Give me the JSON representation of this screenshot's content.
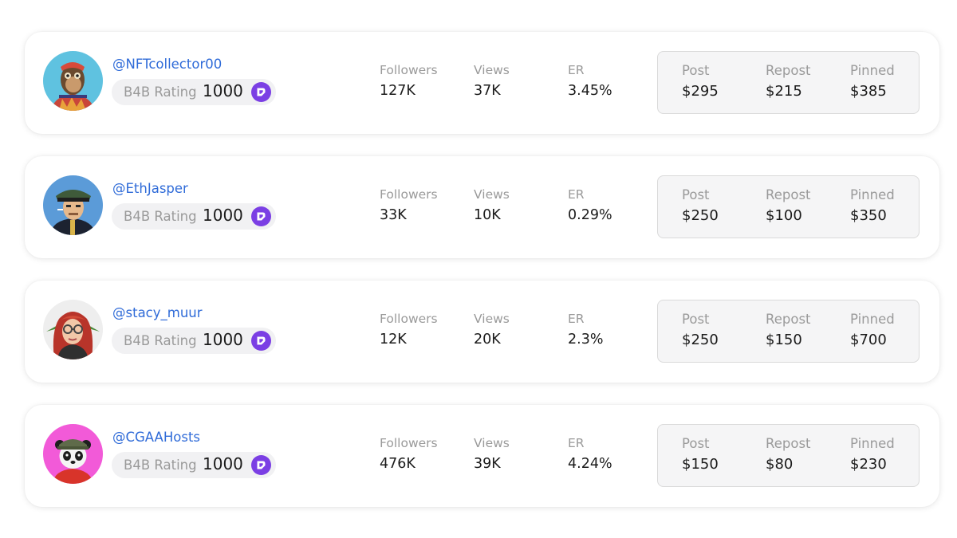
{
  "rating_label": "B4B Rating",
  "stat_labels": {
    "followers": "Followers",
    "views": "Views",
    "er": "ER"
  },
  "price_labels": {
    "post": "Post",
    "repost": "Repost",
    "pinned": "Pinned"
  },
  "colors": {
    "handle": "#2f6bd8",
    "rating_icon": "#7b3fe4",
    "muted_text": "#9a9a9a"
  },
  "influencers": [
    {
      "handle": "@NFTcollector00",
      "avatar_icon": "ape-avatar-icon",
      "rating": "1000",
      "followers": "127K",
      "views": "37K",
      "er": "3.45%",
      "post_price": "$295",
      "repost_price": "$215",
      "pinned_price": "$385"
    },
    {
      "handle": "@EthJasper",
      "avatar_icon": "officer-avatar-icon",
      "rating": "1000",
      "followers": "33K",
      "views": "10K",
      "er": "0.29%",
      "post_price": "$250",
      "repost_price": "$100",
      "pinned_price": "$350"
    },
    {
      "handle": "@stacy_muur",
      "avatar_icon": "redhead-avatar-icon",
      "rating": "1000",
      "followers": "12K",
      "views": "20K",
      "er": "2.3%",
      "post_price": "$250",
      "repost_price": "$150",
      "pinned_price": "$700"
    },
    {
      "handle": "@CGAAHosts",
      "avatar_icon": "panda-avatar-icon",
      "rating": "1000",
      "followers": "476K",
      "views": "39K",
      "er": "4.24%",
      "post_price": "$150",
      "repost_price": "$80",
      "pinned_price": "$230"
    }
  ]
}
